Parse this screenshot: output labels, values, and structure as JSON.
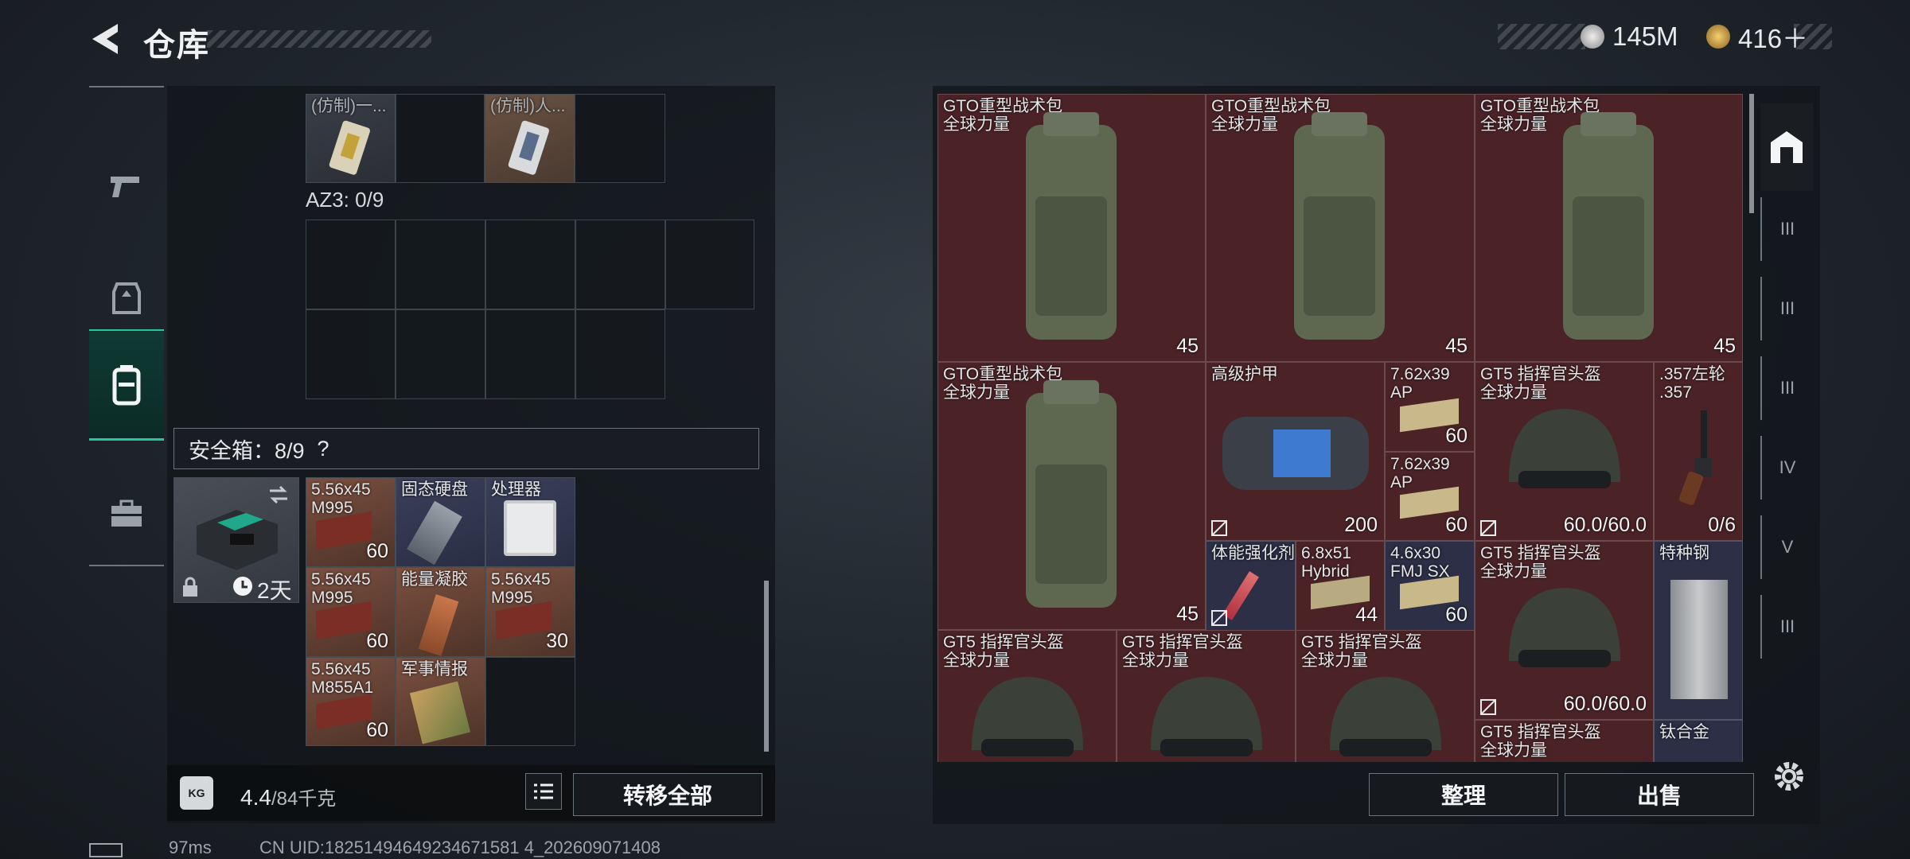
{
  "header": {
    "title": "仓库",
    "silver": "145M",
    "gold": "416＋"
  },
  "left": {
    "top_items": [
      {
        "name": "(仿制)一..."
      },
      {
        "name": "(仿制)人..."
      }
    ],
    "az3_label": "AZ3: 0/9",
    "safe_label": "安全箱：8/9",
    "safe_help": "?",
    "safe_timer": "2天",
    "safe_items": [
      {
        "name": "5.56x45\nM995",
        "count": "60"
      },
      {
        "name": "固态硬盘",
        "count": ""
      },
      {
        "name": "处理器",
        "count": ""
      },
      {
        "name": "5.56x45\nM995",
        "count": "60"
      },
      {
        "name": "能量凝胶",
        "count": ""
      },
      {
        "name": "5.56x45\nM995",
        "count": "30"
      },
      {
        "name": "5.56x45\nM855A1",
        "count": "60"
      },
      {
        "name": "军事情报",
        "count": ""
      }
    ],
    "weight_value": "4.4",
    "weight_max": "/84千克",
    "transfer_label": "转移全部"
  },
  "right": {
    "items": [
      {
        "name": "GTO重型战术包\n全球力量",
        "count": "45"
      },
      {
        "name": "GTO重型战术包\n全球力量",
        "count": "45"
      },
      {
        "name": "GTO重型战术包\n全球力量",
        "count": "45"
      },
      {
        "name": "GTO重型战术包\n全球力量",
        "count": "45"
      },
      {
        "name": "高级护甲",
        "count": "200"
      },
      {
        "name": "7.62x39\nAP",
        "count": "60"
      },
      {
        "name": "GT5 指挥官头盔\n全球力量",
        "count": "60.0/60.0"
      },
      {
        "name": ".357左轮\n.357",
        "count": "0/6"
      },
      {
        "name": "7.62x39\nAP",
        "count": "60"
      },
      {
        "name": "体能强化剂",
        "count": ""
      },
      {
        "name": "6.8x51\nHybrid",
        "count": "44"
      },
      {
        "name": "4.6x30\nFMJ SX",
        "count": "60"
      },
      {
        "name": "GT5 指挥官头盔\n全球力量",
        "count": "60.0/60.0"
      },
      {
        "name": "特种钢",
        "count": ""
      },
      {
        "name": "GT5 指挥官头盔\n全球力量",
        "count": ""
      },
      {
        "name": "GT5 指挥官头盔\n全球力量",
        "count": ""
      },
      {
        "name": "GT5 指挥官头盔\n全球力量",
        "count": ""
      },
      {
        "name": "GT5 指挥官头盔\n全球力量",
        "count": ""
      },
      {
        "name": "钛合金",
        "count": ""
      }
    ],
    "sort_label": "整理",
    "sell_label": "出售",
    "side_tabs": [
      "III",
      "III",
      "III",
      "IV",
      "V",
      "III"
    ]
  },
  "status": {
    "ping": "97ms",
    "uid": "CN UID:18251494649234671581 4_202609071408"
  },
  "colors": {
    "accent": "#27c79a",
    "red_cell": "#4b2327"
  }
}
